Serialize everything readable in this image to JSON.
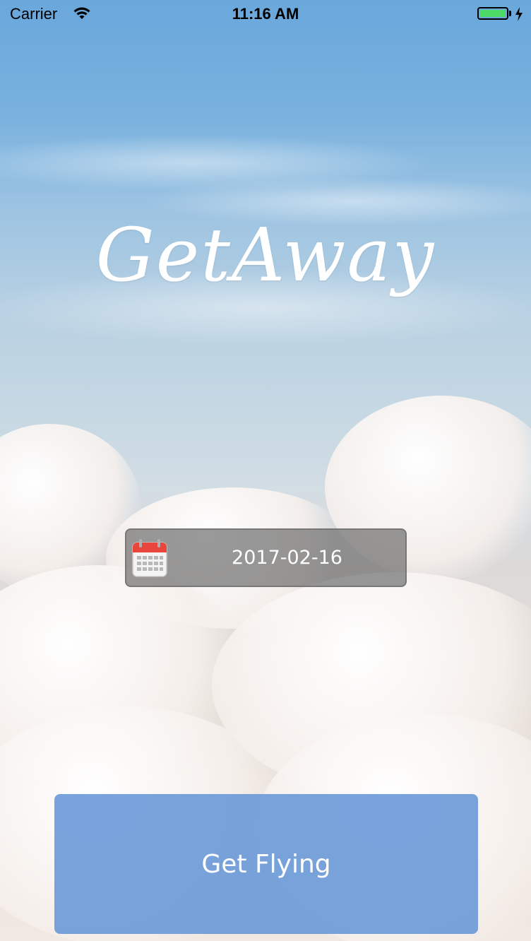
{
  "status_bar": {
    "carrier": "Carrier",
    "time": "11:16 AM",
    "battery_color": "#4cd964",
    "icons": [
      "wifi-icon",
      "battery-icon",
      "charging-bolt-icon"
    ]
  },
  "app": {
    "title": "GetAway"
  },
  "date_picker": {
    "icon": "calendar-icon",
    "value": "2017-02-16"
  },
  "primary_action": {
    "label": "Get Flying",
    "color": "#6696d7"
  }
}
